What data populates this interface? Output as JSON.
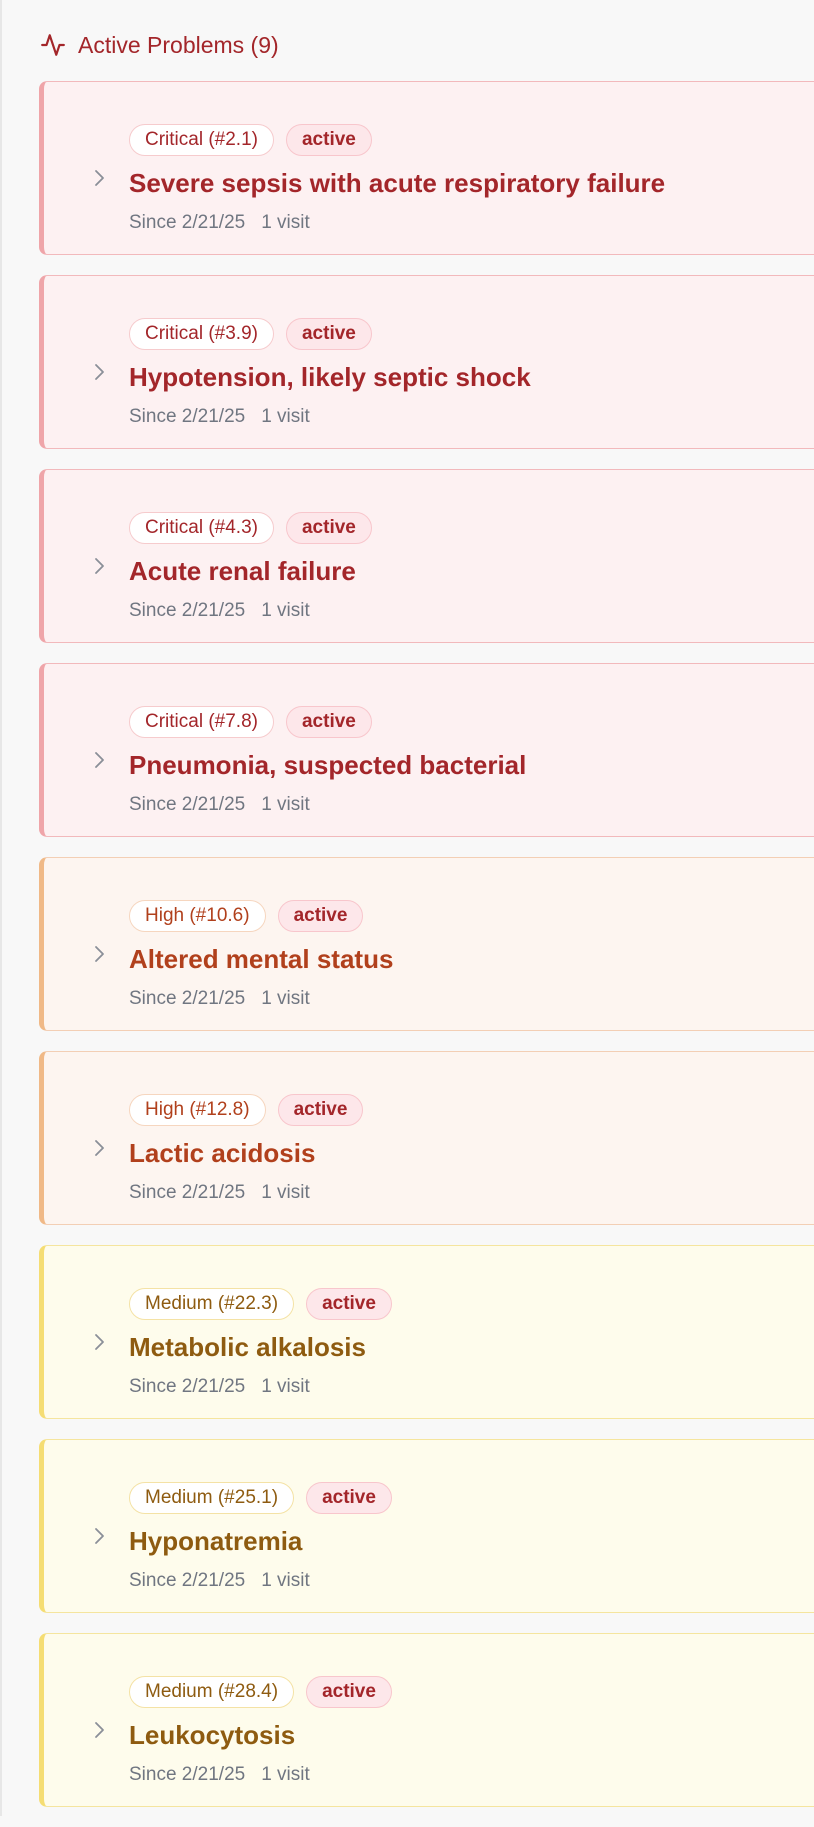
{
  "section": {
    "title": "Active Problems (9)",
    "icon": "activity-icon",
    "accent_color": "#a3262a"
  },
  "problems": [
    {
      "severity": "critical",
      "severity_label": "Critical (#2.1)",
      "status": "active",
      "title": "Severe sepsis with acute respiratory failure",
      "since": "Since 2/21/25",
      "visits": "1 visit"
    },
    {
      "severity": "critical",
      "severity_label": "Critical (#3.9)",
      "status": "active",
      "title": "Hypotension, likely septic shock",
      "since": "Since 2/21/25",
      "visits": "1 visit"
    },
    {
      "severity": "critical",
      "severity_label": "Critical (#4.3)",
      "status": "active",
      "title": "Acute renal failure",
      "since": "Since 2/21/25",
      "visits": "1 visit"
    },
    {
      "severity": "critical",
      "severity_label": "Critical (#7.8)",
      "status": "active",
      "title": "Pneumonia, suspected bacterial",
      "since": "Since 2/21/25",
      "visits": "1 visit"
    },
    {
      "severity": "high",
      "severity_label": "High (#10.6)",
      "status": "active",
      "title": "Altered mental status",
      "since": "Since 2/21/25",
      "visits": "1 visit"
    },
    {
      "severity": "high",
      "severity_label": "High (#12.8)",
      "status": "active",
      "title": "Lactic acidosis",
      "since": "Since 2/21/25",
      "visits": "1 visit"
    },
    {
      "severity": "medium",
      "severity_label": "Medium (#22.3)",
      "status": "active",
      "title": "Metabolic alkalosis",
      "since": "Since 2/21/25",
      "visits": "1 visit"
    },
    {
      "severity": "medium",
      "severity_label": "Medium (#25.1)",
      "status": "active",
      "title": "Hyponatremia",
      "since": "Since 2/21/25",
      "visits": "1 visit"
    },
    {
      "severity": "medium",
      "severity_label": "Medium (#28.4)",
      "status": "active",
      "title": "Leukocytosis",
      "since": "Since 2/21/25",
      "visits": "1 visit"
    }
  ],
  "severity_colors": {
    "critical": "#a3262a",
    "high": "#b1401c",
    "medium": "#8e5b10"
  },
  "chevron_icon": "chevron-right-icon"
}
